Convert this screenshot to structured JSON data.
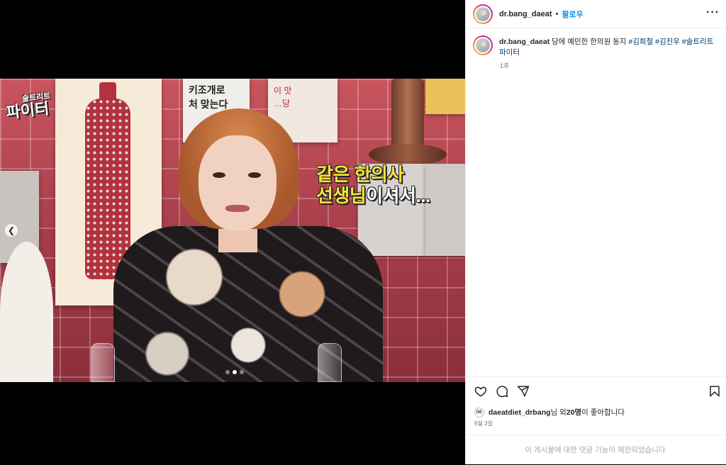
{
  "post": {
    "username": "dr.bang_daeat",
    "follow_label": "팔로우",
    "separator": "•",
    "more_label": "···",
    "caption": {
      "username": "dr.bang_daeat",
      "text": " 당에 예민한 한의원 동지 ",
      "hashtags": [
        "#김희철",
        "#김진우",
        "#술트리트파이터"
      ]
    },
    "age": "1주",
    "likes": {
      "avatar_text": "DE",
      "liker": "daeatdiet_drbang",
      "suffix_1": "님 외 ",
      "count": "20명",
      "suffix_2": "이 좋아합니다"
    },
    "date": "8월 3일",
    "comments_disabled": "이 게시물에 대한 댓글 기능이 제한되었습니다."
  },
  "media": {
    "subtitle_line1": "같은 한의사",
    "subtitle_line2_highlight": "선생님",
    "subtitle_line2_rest": "이셔서...",
    "show_logo_line1": "술트리트",
    "show_logo_line2": "파이터",
    "poster_text_1": "키조개로\n처 맞는다",
    "poster_text_2": "이 맛\n…당",
    "prev_icon": "chevron-left-icon",
    "carousel_total": 3,
    "carousel_active": 2
  },
  "icons": {
    "like": "heart-icon",
    "comment": "comment-bubble-icon",
    "share": "paper-plane-icon",
    "save": "bookmark-icon"
  }
}
